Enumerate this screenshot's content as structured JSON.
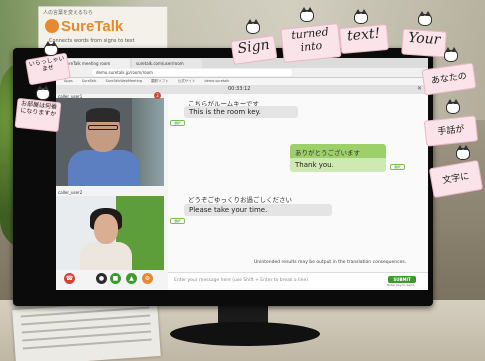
{
  "sign": {
    "top_text": "人の言葉を変えるなら",
    "logo": "SureTalk",
    "subtitle": "Connects words from signs to text"
  },
  "browser": {
    "tabs": [
      "SureTalk meeting room",
      "suretalk.com/user/room"
    ],
    "url": "demo.suretalk.jp/room/room",
    "bookmarks": [
      "Apps",
      "SureTalk",
      "SureTalkWebMeeting",
      "翻訳ソフト",
      "公式サイト",
      "demo.suretalk"
    ],
    "clock": "00:33:12"
  },
  "videos": {
    "caller1_label": "caller_user1",
    "caller1_badge": "2",
    "caller2_label": "caller_user2"
  },
  "chat": {
    "msg1_jp": "こちらがルームキーです",
    "msg1_en": "This is the room key.",
    "msg2_jp": "ありがとうございます",
    "msg2_en": "Thank you.",
    "msg3_jp": "どうぞごゆっくりお過ごしください",
    "msg3_en": "Please take your time.",
    "translate_label": "翻訳",
    "warning": "Unintended results may be output in the translation consequences.",
    "input_placeholder": "Enter your message here (use Shift + Enter to break a line)",
    "submit_label": "SUBMIT",
    "enter_hint": "Enter key to Send"
  },
  "notes": {
    "note1": "いらっしゃいませ",
    "note2": "お部屋は何番になりますか",
    "sign": "Sign",
    "turned_into": "turned into",
    "text": "text!",
    "your": "Your",
    "anata": "あなたの",
    "shuwa": "手話が",
    "moji": "文字に"
  }
}
